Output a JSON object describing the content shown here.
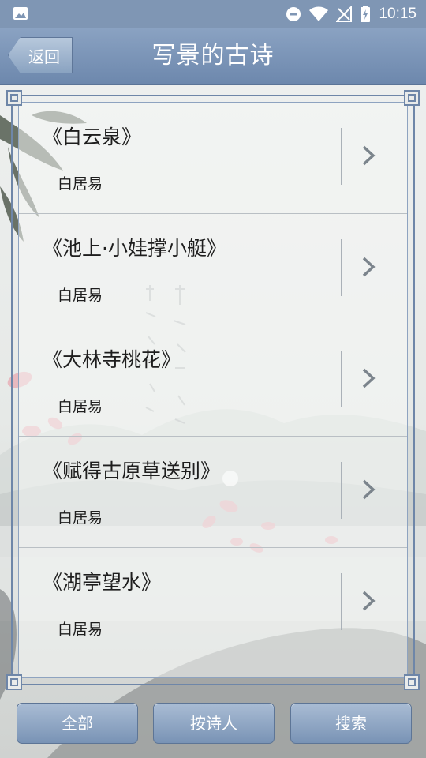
{
  "status_bar": {
    "time": "10:15"
  },
  "header": {
    "back_label": "返回",
    "title": "写景的古诗"
  },
  "poems": [
    {
      "title": "《白云泉》",
      "author": "白居易"
    },
    {
      "title": "《池上·小娃撑小艇》",
      "author": "白居易"
    },
    {
      "title": "《大林寺桃花》",
      "author": "白居易"
    },
    {
      "title": "《赋得古原草送别》",
      "author": "白居易"
    },
    {
      "title": "《湖亭望水》",
      "author": "白居易"
    }
  ],
  "bottom_bar": {
    "all_label": "全部",
    "by_poet_label": "按诗人",
    "search_label": "搜索"
  },
  "colors": {
    "header": "#7f96b4",
    "button": "#8aa3c1",
    "frame": "#6e86a8"
  }
}
